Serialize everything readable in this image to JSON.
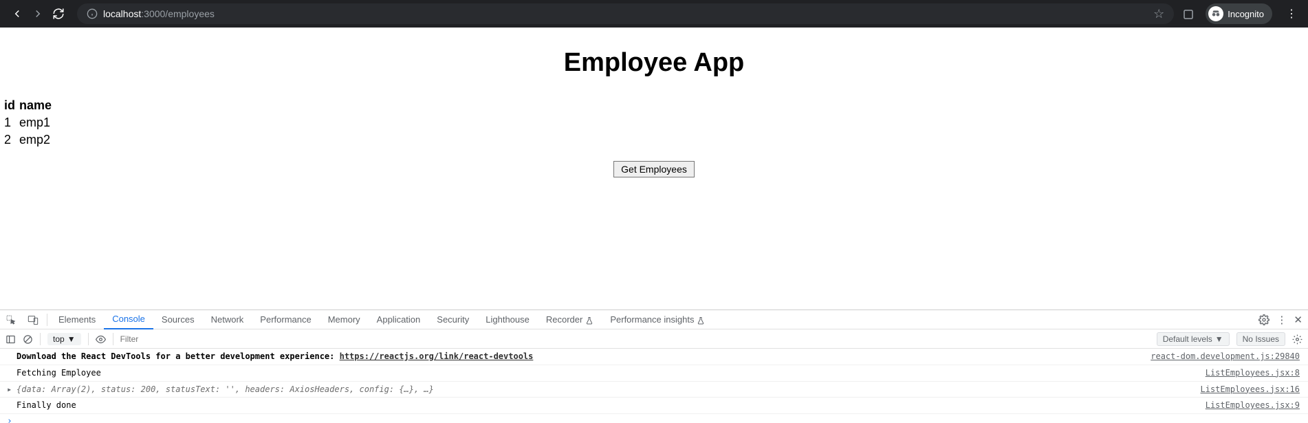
{
  "browser": {
    "url_host": "localhost",
    "url_port_path": ":3000/employees",
    "incognito_label": "Incognito"
  },
  "page": {
    "title": "Employee App",
    "table": {
      "headers": [
        "id",
        "name"
      ],
      "rows": [
        {
          "id": "1",
          "name": "emp1"
        },
        {
          "id": "2",
          "name": "emp2"
        }
      ]
    },
    "button_label": "Get Employees"
  },
  "devtools": {
    "tabs": [
      "Elements",
      "Console",
      "Sources",
      "Network",
      "Performance",
      "Memory",
      "Application",
      "Security",
      "Lighthouse",
      "Recorder",
      "Performance insights"
    ],
    "active_tab": "Console",
    "toolbar": {
      "context": "top",
      "filter_placeholder": "Filter",
      "levels_label": "Default levels",
      "issues_label": "No Issues"
    },
    "logs": [
      {
        "type": "devtools-hint",
        "text_bold": "Download the React DevTools for a better development experience: ",
        "link": "https://reactjs.org/link/react-devtools",
        "source": "react-dom.development.js:29840"
      },
      {
        "type": "log",
        "text": "Fetching Employee",
        "source": "ListEmployees.jsx:8"
      },
      {
        "type": "object",
        "text": "{data: Array(2), status: 200, statusText: '', headers: AxiosHeaders, config: {…}, …}",
        "source": "ListEmployees.jsx:16"
      },
      {
        "type": "log",
        "text": "Finally done",
        "source": "ListEmployees.jsx:9"
      }
    ],
    "prompt": "›"
  }
}
